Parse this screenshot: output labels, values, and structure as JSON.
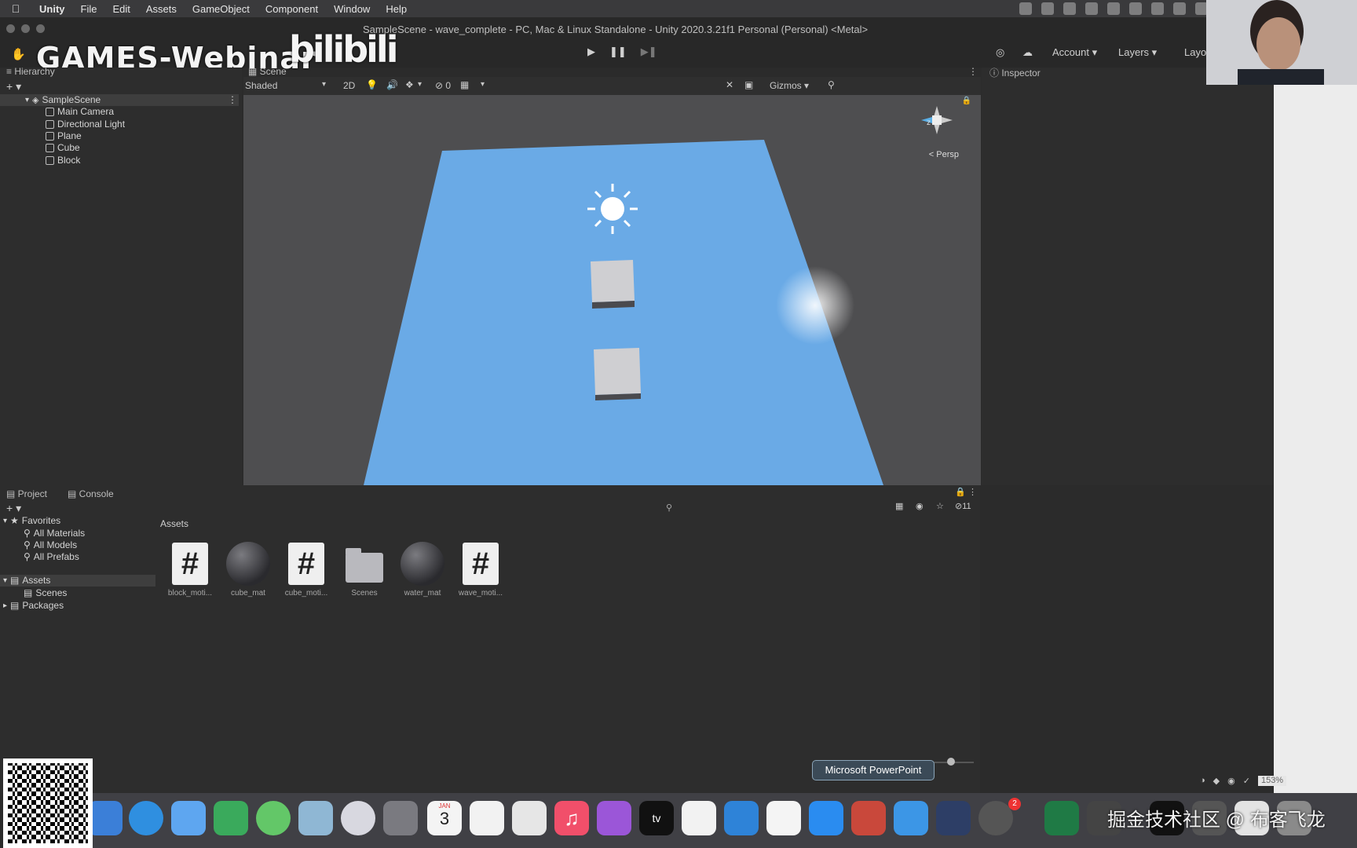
{
  "menubar": {
    "app": "Unity",
    "items": [
      "File",
      "Edit",
      "Assets",
      "GameObject",
      "Component",
      "Window",
      "Help"
    ]
  },
  "window": {
    "title": "SampleScene - wave_complete - PC, Mac & Linux Standalone - Unity 2020.3.21f1 Personal (Personal) <Metal>"
  },
  "overlay": {
    "games_text": "GAMES-Webinar",
    "bili_text": "bilibili",
    "watermark": "掘金技术社区 @ 布客飞龙"
  },
  "toolbar": {
    "account": "Account",
    "layers": "Layers",
    "layout": "Layo"
  },
  "hierarchy": {
    "tab": "Hierarchy",
    "scene": "SampleScene",
    "items": [
      "Main Camera",
      "Directional Light",
      "Plane",
      "Cube",
      "Block"
    ]
  },
  "scene_panel": {
    "tab_scene": "Scene",
    "shading": "Shaded",
    "mode_2d": "2D",
    "hidden_count": "0",
    "gizmos": "Gizmos",
    "persp": "< Persp",
    "axis_z": "z"
  },
  "inspector": {
    "tab": "Inspector"
  },
  "project": {
    "tab_project": "Project",
    "tab_console": "Console",
    "favorites_label": "Favorites",
    "favorites": [
      "All Materials",
      "All Models",
      "All Prefabs"
    ],
    "assets_root": "Assets",
    "scenes_folder": "Scenes",
    "packages": "Packages",
    "breadcrumb": "Assets",
    "hidden_count": "11",
    "assets": [
      {
        "name": "block_moti...",
        "kind": "script"
      },
      {
        "name": "cube_mat",
        "kind": "material"
      },
      {
        "name": "cube_moti...",
        "kind": "script"
      },
      {
        "name": "Scenes",
        "kind": "folder"
      },
      {
        "name": "water_mat",
        "kind": "material"
      },
      {
        "name": "wave_moti...",
        "kind": "script"
      }
    ]
  },
  "dock": {
    "tooltip": "Microsoft PowerPoint",
    "calendar_month": "JAN",
    "calendar_day": "3",
    "tv_label": "tv",
    "badge": "2"
  },
  "status_right": {
    "zoom": "153%"
  },
  "colors": {
    "plane": "#6aaae6",
    "scene_bg": "#4e4e50",
    "panel_bg": "#2d2d2d"
  }
}
